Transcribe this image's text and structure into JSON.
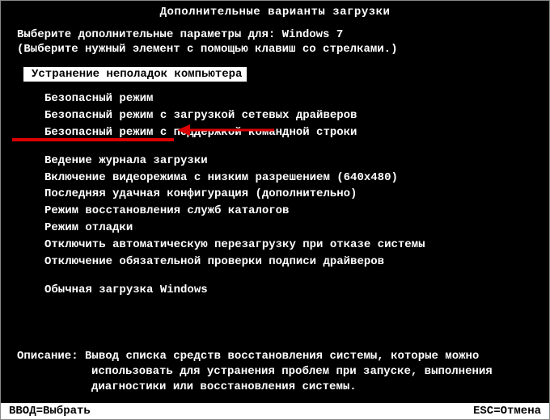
{
  "title": "Дополнительные варианты загрузки",
  "prompt": "Выберите дополнительные параметры для: Windows 7",
  "hint": "(Выберите нужный элемент с помощью клавиш со стрелками.)",
  "selected": "Устранение неполадок компьютера",
  "options_group1": [
    "Безопасный режим",
    "Безопасный режим с загрузкой сетевых драйверов",
    "Безопасный режим с поддержкой командной строки"
  ],
  "options_group2": [
    "Ведение журнала загрузки",
    "Включение видеорежима с низким разрешением (640x480)",
    "Последняя удачная конфигурация (дополнительно)",
    "Режим восстановления служб каталогов",
    "Режим отладки",
    "Отключить автоматическую перезагрузку при отказе системы",
    "Отключение обязательной проверки подписи драйверов"
  ],
  "options_group3": [
    "Обычная загрузка Windows"
  ],
  "description_label": "Описание:",
  "description_line1": "Вывод списка средств восстановления системы, которые можно",
  "description_line2": "использовать для устранения проблем при запуске, выполнения",
  "description_line3": "диагностики или восстановления системы.",
  "footer_left": "ВВОД=Выбрать",
  "footer_right": "ESC=Отмена",
  "annotation": {
    "arrow_color": "#d00",
    "underline_color": "#d00"
  }
}
